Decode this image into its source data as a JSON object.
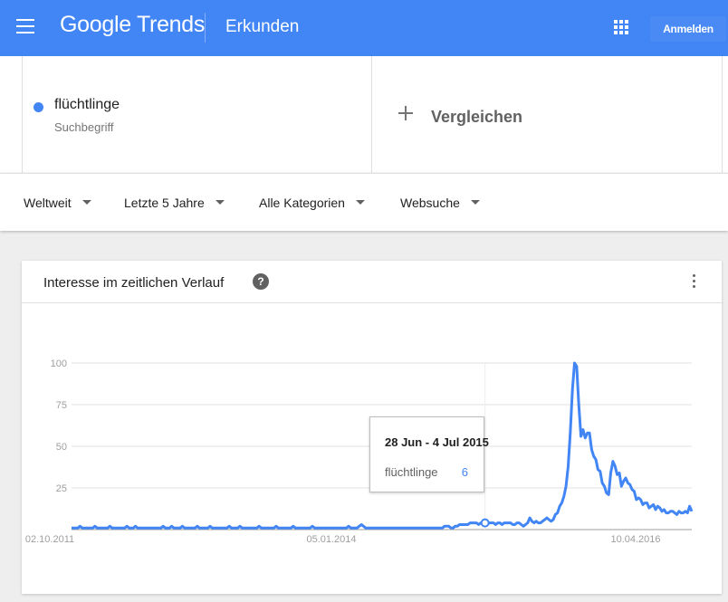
{
  "header": {
    "brand": "Google Trends",
    "page_title": "Erkunden",
    "signin_label": "Anmelden",
    "color": "#4285f4"
  },
  "terms": {
    "items": [
      {
        "label": "flüchtlinge",
        "type": "Suchbegriff",
        "color": "#4285f4"
      }
    ],
    "compare_label": "Vergleichen"
  },
  "filters": {
    "region": "Weltweit",
    "time": "Letzte 5 Jahre",
    "category": "Alle Kategorien",
    "search_type": "Websuche"
  },
  "card": {
    "title": "Interesse im zeitlichen Verlauf",
    "help_symbol": "?"
  },
  "tooltip": {
    "date": "28 Jun - 4 Jul 2015",
    "term": "flüchtlinge",
    "value": "6"
  },
  "chart_data": {
    "type": "line",
    "x_tick_labels": [
      "02.10.2011",
      "05.01.2014",
      "10.04.2016"
    ],
    "y_tick_labels": [
      "100",
      "75",
      "50",
      "25"
    ],
    "ylim": [
      0,
      100
    ],
    "grid": true,
    "line_color": "#4285f4",
    "series": [
      {
        "name": "flüchtlinge",
        "values": [
          1,
          1,
          1,
          1,
          2,
          1,
          1,
          1,
          1,
          1,
          1,
          2,
          1,
          1,
          1,
          1,
          1,
          1,
          2,
          1,
          1,
          1,
          1,
          1,
          1,
          1,
          2,
          1,
          1,
          1,
          2,
          1,
          1,
          1,
          1,
          1,
          1,
          1,
          1,
          1,
          1,
          1,
          1,
          2,
          1,
          1,
          1,
          2,
          1,
          1,
          1,
          1,
          2,
          1,
          1,
          1,
          1,
          1,
          1,
          2,
          1,
          1,
          1,
          1,
          1,
          2,
          1,
          1,
          1,
          1,
          1,
          1,
          1,
          1,
          2,
          1,
          1,
          1,
          1,
          2,
          1,
          1,
          1,
          1,
          1,
          1,
          1,
          1,
          2,
          1,
          1,
          1,
          1,
          1,
          1,
          1,
          2,
          1,
          1,
          1,
          1,
          1,
          1,
          1,
          2,
          1,
          1,
          1,
          1,
          1,
          1,
          1,
          1,
          2,
          1,
          1,
          1,
          1,
          1,
          1,
          1,
          1,
          1,
          1,
          1,
          1,
          1,
          1,
          1,
          1,
          2,
          1,
          1,
          1,
          1,
          2,
          3,
          2,
          1,
          1,
          1,
          1,
          1,
          1,
          1,
          1,
          1,
          1,
          1,
          1,
          1,
          1,
          1,
          1,
          1,
          1,
          1,
          1,
          1,
          1,
          1,
          1,
          1,
          1,
          1,
          1,
          1,
          1,
          1,
          1,
          1,
          1,
          1,
          1,
          1,
          2,
          2,
          2,
          1,
          1,
          2,
          2,
          3,
          3,
          3,
          3,
          3,
          4,
          4,
          4,
          4,
          3,
          4,
          4,
          4,
          3,
          4,
          4,
          4,
          3,
          4,
          4,
          3,
          4,
          4,
          4,
          4,
          3,
          3,
          4,
          4,
          3,
          2,
          3,
          4,
          7,
          5,
          4,
          5,
          4,
          4,
          5,
          6,
          7,
          6,
          5,
          6,
          9,
          10,
          14,
          16,
          20,
          26,
          38,
          58,
          84,
          100,
          98,
          75,
          56,
          60,
          55,
          58,
          58,
          48,
          44,
          42,
          36,
          35,
          28,
          26,
          22,
          21,
          34,
          41,
          38,
          33,
          34,
          26,
          29,
          31,
          28,
          27,
          24,
          23,
          18,
          19,
          18,
          15,
          16,
          16,
          13,
          14,
          15,
          12,
          14,
          13,
          11,
          12,
          10,
          10,
          11,
          11,
          10,
          9,
          11,
          10,
          10,
          11,
          10,
          14,
          11
        ]
      }
    ]
  }
}
